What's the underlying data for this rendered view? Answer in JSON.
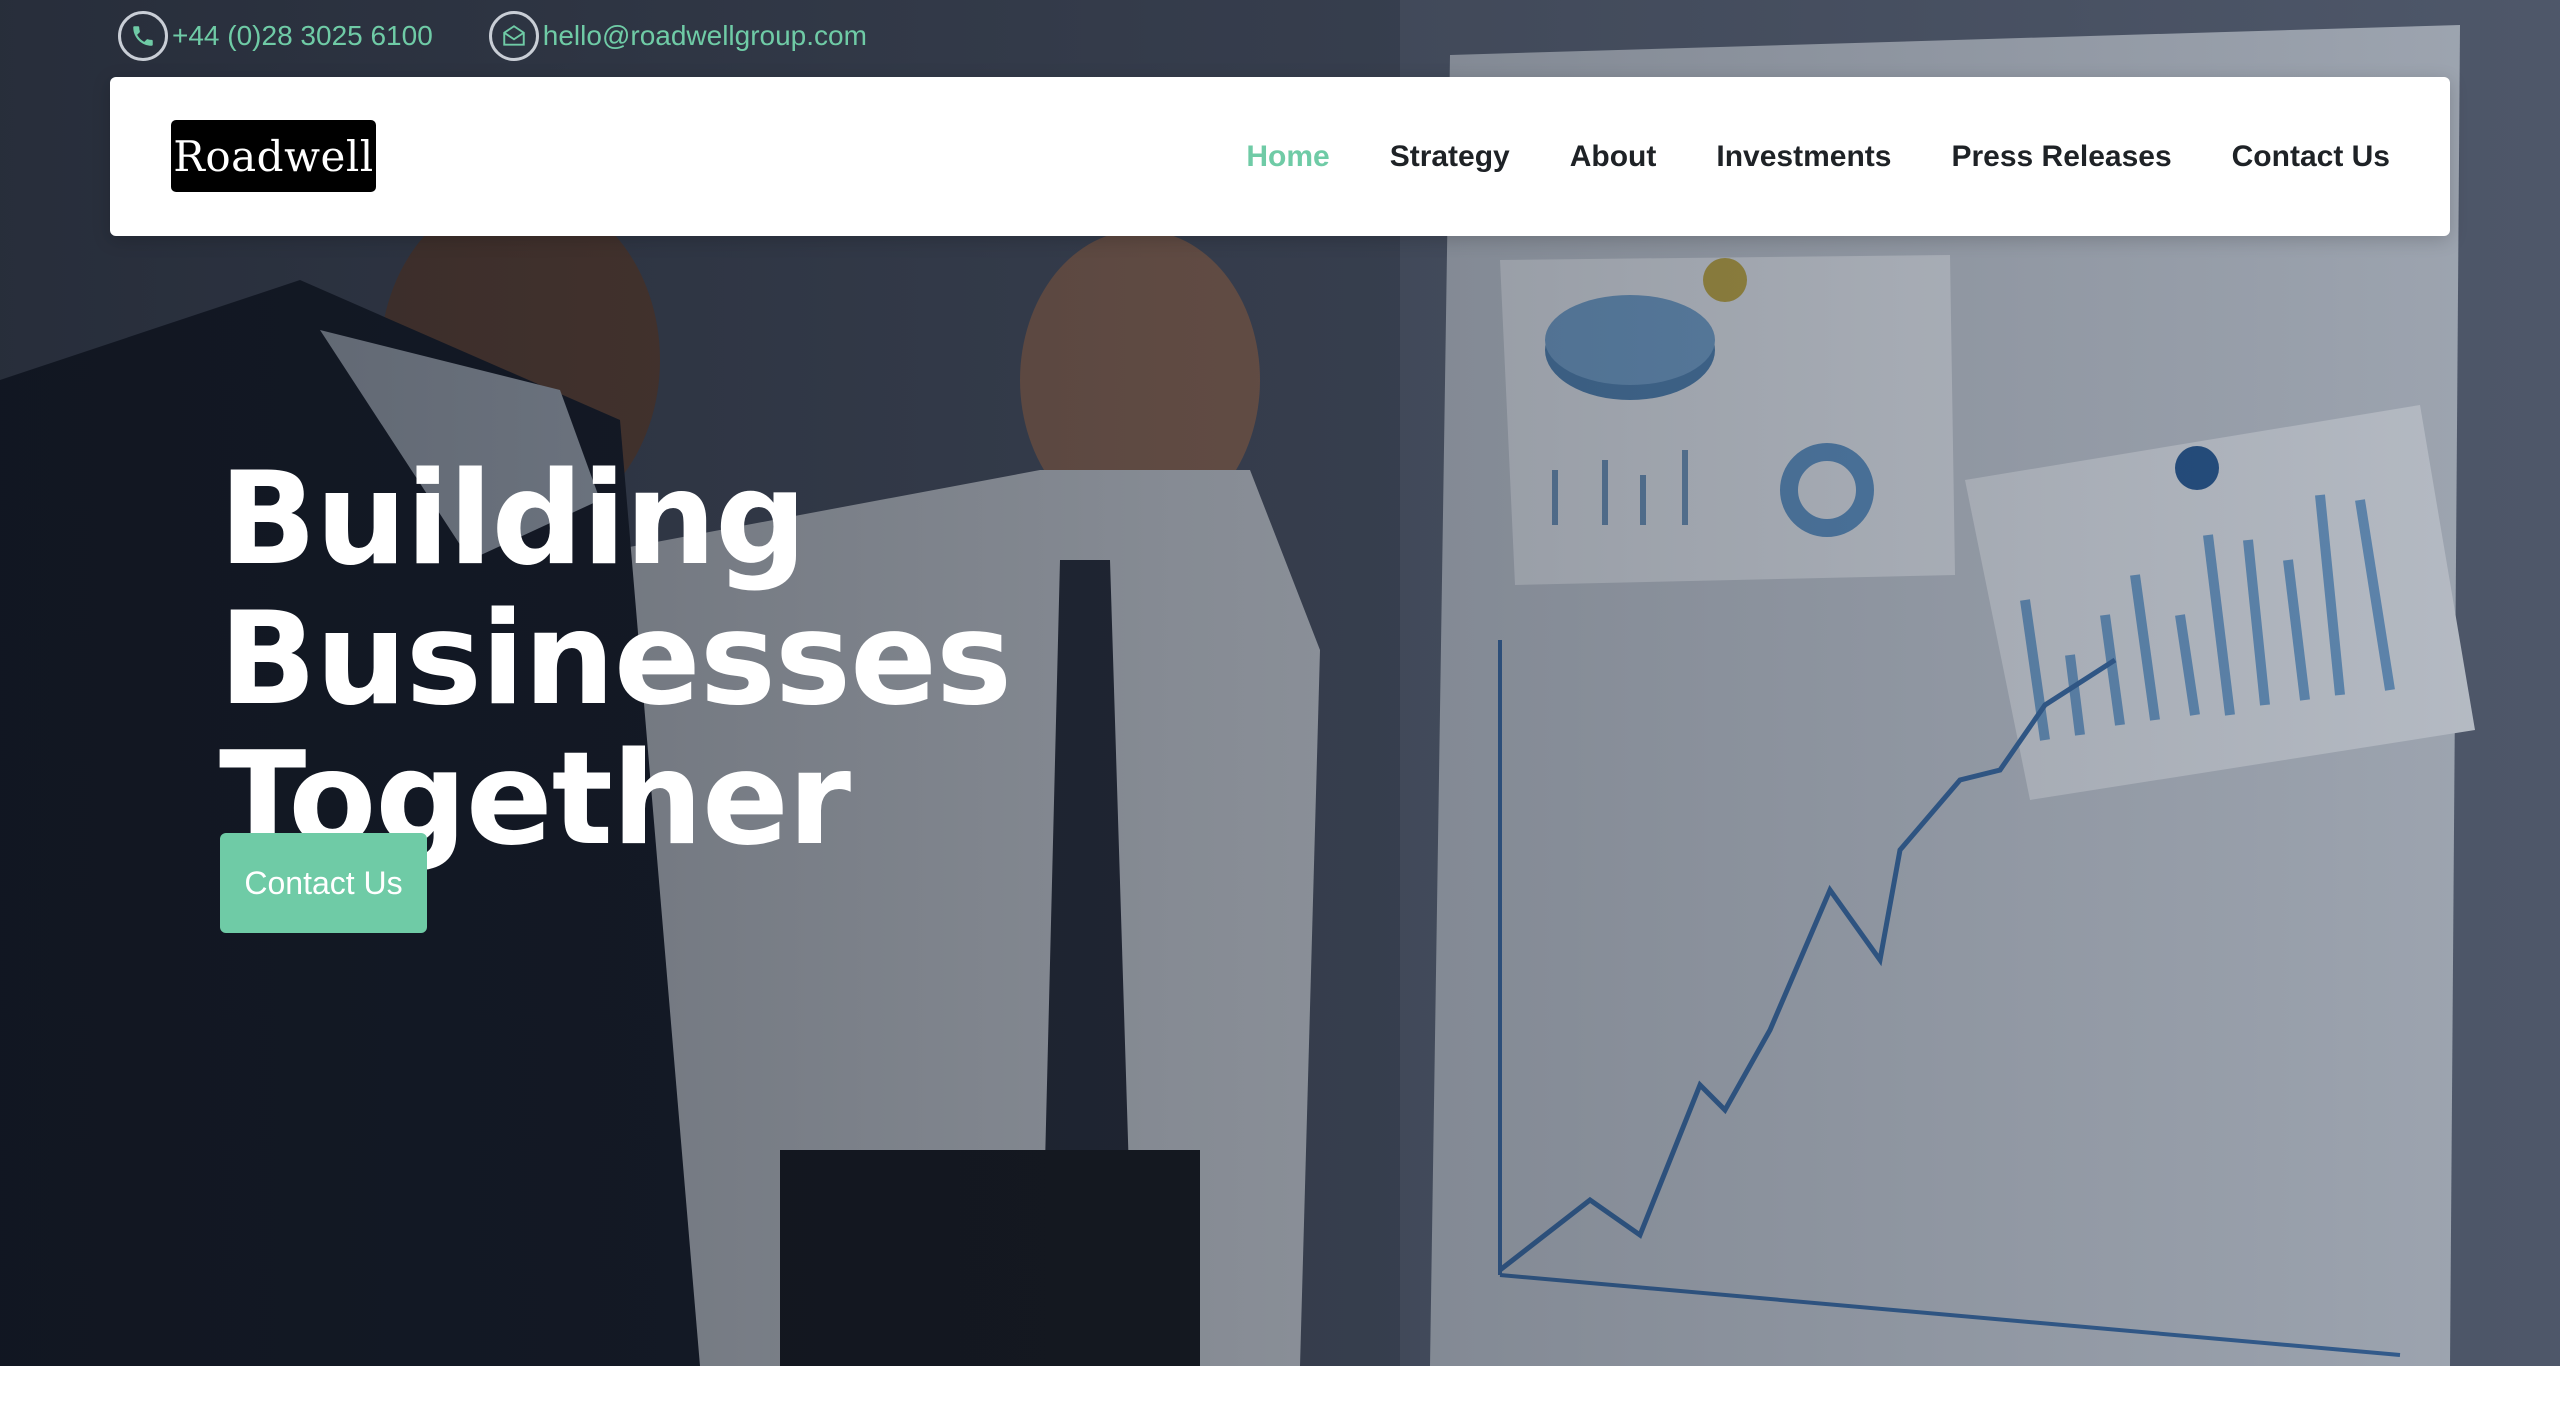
{
  "topbar": {
    "phone": "+44 (0)28 3025 6100",
    "email": "hello@roadwellgroup.com"
  },
  "brand": {
    "logo_text": "Roadwell"
  },
  "nav": {
    "items": [
      {
        "label": "Home",
        "active": true
      },
      {
        "label": "Strategy",
        "active": false
      },
      {
        "label": "About",
        "active": false
      },
      {
        "label": "Investments",
        "active": false
      },
      {
        "label": "Press Releases",
        "active": false
      },
      {
        "label": "Contact Us",
        "active": false
      }
    ]
  },
  "hero": {
    "headline_line1": "Building Businesses",
    "headline_line2": "Together",
    "cta_label": "Contact Us",
    "image_icon": "business-meeting-photo"
  },
  "colors": {
    "accent": "#6fcba6",
    "nav_text": "#1e2226",
    "logo_bg": "#000000"
  },
  "icons": {
    "phone": "phone-icon",
    "email": "envelope-icon"
  }
}
